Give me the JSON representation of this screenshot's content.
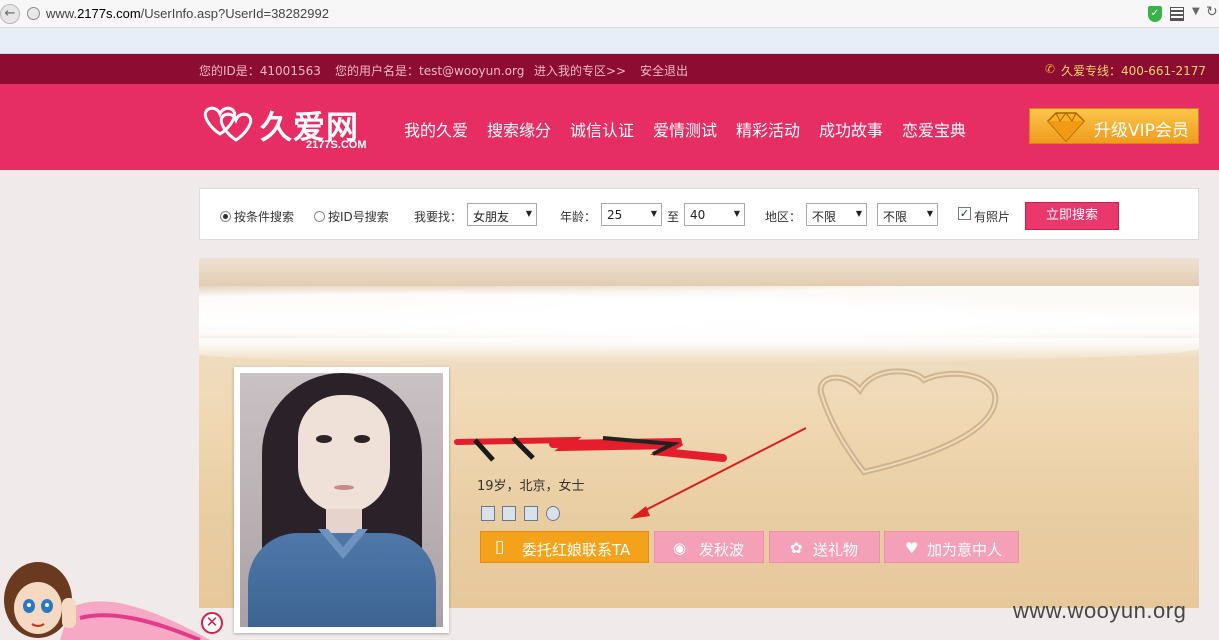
{
  "browser": {
    "url_prefix": "www.",
    "url_domain": "2177s.com",
    "url_path": "/UserInfo.asp?UserId=38282992"
  },
  "topbar": {
    "my_id": "您的ID是：41001563",
    "my_username": "您的用户名是：test@wooyun.org",
    "enter_zone": "进入我的专区>>",
    "logout": "安全退出",
    "hotline": "久爱专线：400-661-2177"
  },
  "header": {
    "logo_text": "久爱网",
    "logo_domain": "2177S.COM",
    "nav": [
      "我的久爱",
      "搜索缘分",
      "诚信认证",
      "爱情测试",
      "精彩活动",
      "成功故事",
      "恋爱宝典"
    ],
    "vip_button": "升级VIP会员"
  },
  "search": {
    "mode_condition": "按条件搜索",
    "mode_id": "按ID号搜索",
    "looking_for_label": "我要找：",
    "looking_for_value": "女朋友",
    "age_label": "年龄：",
    "age_from": "25",
    "age_to_label": "至",
    "age_to": "40",
    "region_label": "地区：",
    "region_1": "不限",
    "region_2": "不限",
    "has_photo": "有照片",
    "submit": "立即搜索"
  },
  "profile": {
    "meta": "19岁，北京，女士",
    "actions": {
      "matchmaker": "委托红娘联系TA",
      "wink": "发秋波",
      "gift": "送礼物",
      "favorite": "加为意中人"
    }
  },
  "watermark": "www.wooyun.org",
  "colors": {
    "top_strip": "#8c0d31",
    "main_nav": "#e62d64",
    "vip_gold": "#f4a21a",
    "action_pink": "#f4a0b9"
  }
}
